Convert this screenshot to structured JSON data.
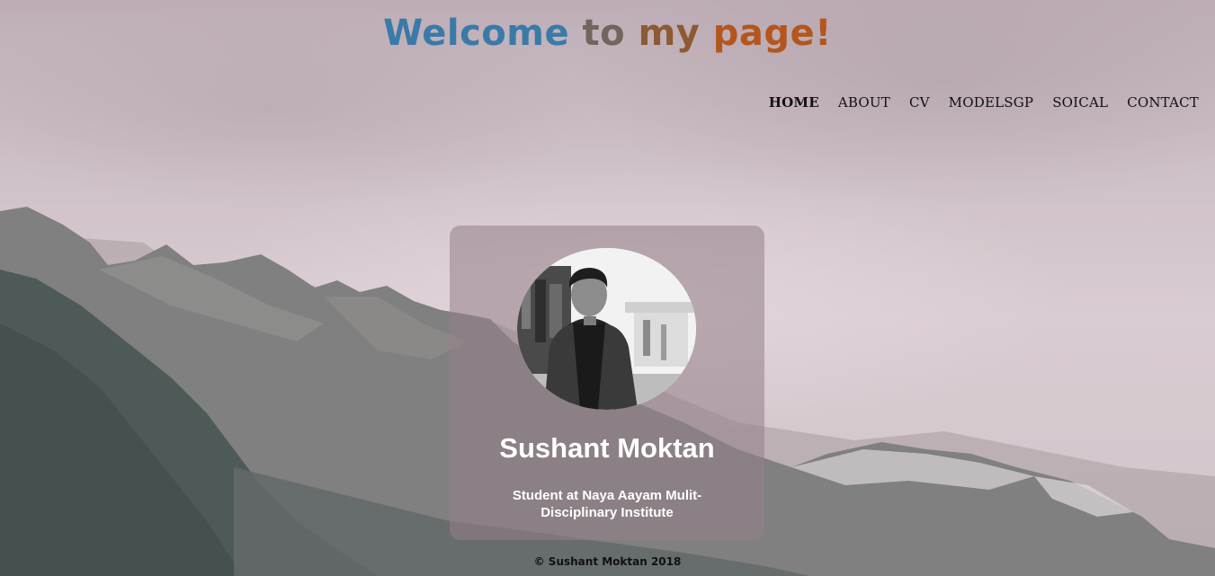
{
  "header": {
    "title_parts": {
      "welcome": "Welcome",
      "to": "to",
      "my": "my",
      "page": "page!"
    },
    "title_colors": [
      "#3a7aa8",
      "#71665d",
      "#8d5a33",
      "#b4561c"
    ]
  },
  "nav": {
    "items": [
      {
        "label": "HOME",
        "active": true
      },
      {
        "label": "ABOUT",
        "active": false
      },
      {
        "label": "CV",
        "active": false
      },
      {
        "label": "MODELSGP",
        "active": false
      },
      {
        "label": "SOICAL",
        "active": false
      },
      {
        "label": "CONTACT",
        "active": false
      }
    ]
  },
  "profile": {
    "name": "Sushant Moktan",
    "subtitle": "Student at Naya Aayam Mulit-Disciplinary Institute",
    "avatar_icon": "person-photo-icon"
  },
  "footer": {
    "text": "© Sushant Moktan 2018"
  },
  "colors": {
    "card_overlay": "#96808a",
    "name_text": "#ffffff"
  }
}
